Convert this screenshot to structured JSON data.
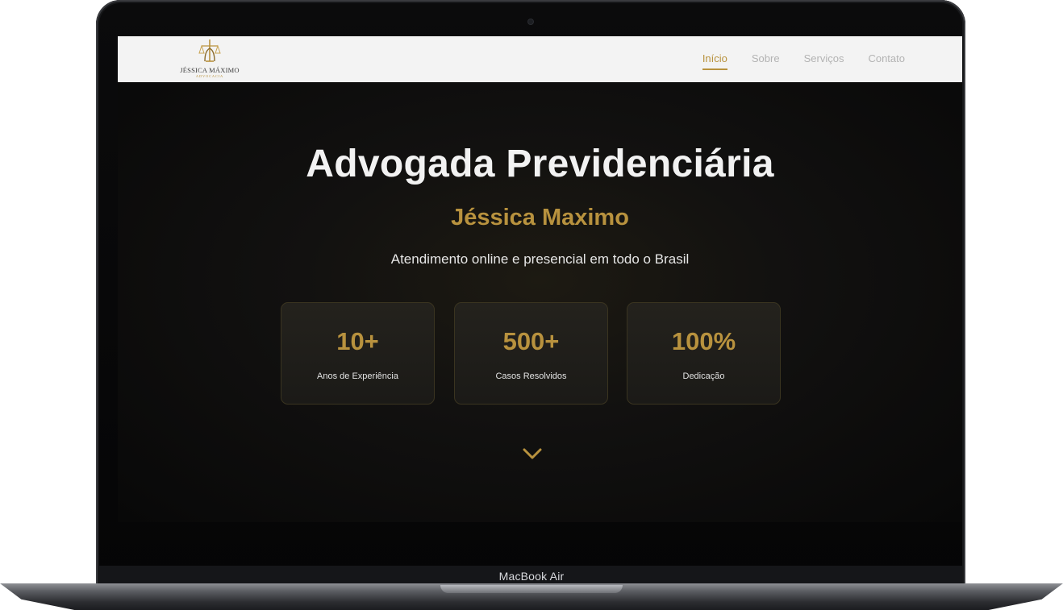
{
  "device": {
    "label": "MacBook Air"
  },
  "logo": {
    "name": "JÉSSICA MÁXIMO",
    "tagline": "ADVOCACIA"
  },
  "nav": {
    "items": [
      {
        "label": "Início",
        "active": true
      },
      {
        "label": "Sobre",
        "active": false
      },
      {
        "label": "Serviços",
        "active": false
      },
      {
        "label": "Contato",
        "active": false
      }
    ]
  },
  "hero": {
    "title": "Advogada Previdenciária",
    "name": "Jéssica Maximo",
    "subtitle": "Atendimento online e presencial em todo o Brasil"
  },
  "stats": [
    {
      "value": "10+",
      "label": "Anos de Experiência"
    },
    {
      "value": "500+",
      "label": "Casos Resolvidos"
    },
    {
      "value": "100%",
      "label": "Dedicação"
    }
  ],
  "icons": {
    "scroll": "chevron-down-icon",
    "logo": "scales-of-justice-icon"
  },
  "colors": {
    "accent": "#b8923e",
    "background": "#0a0a0a",
    "navbar": "#f3f3f3"
  }
}
